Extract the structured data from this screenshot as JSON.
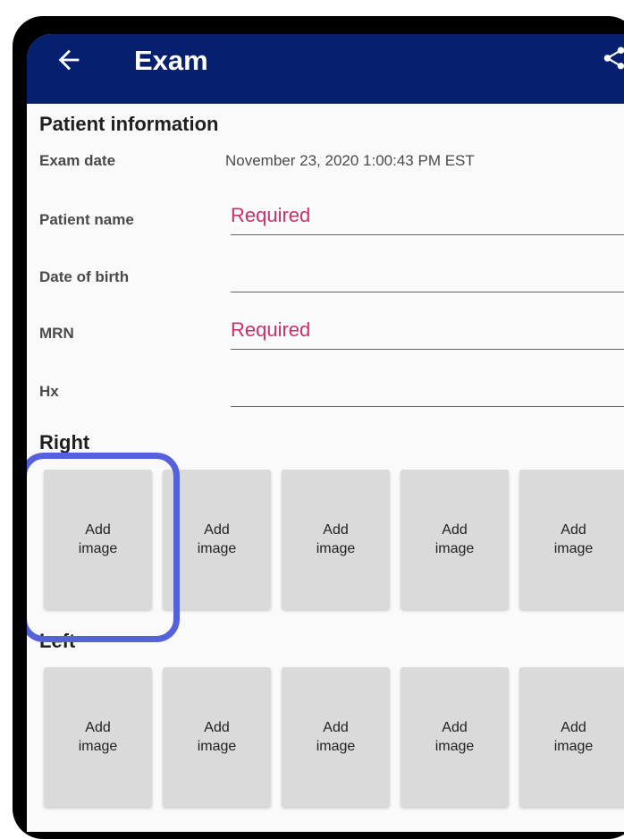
{
  "appbar": {
    "title": "Exam",
    "back_icon": "arrow-left-icon",
    "share_icon": "share-icon"
  },
  "patient_info": {
    "heading": "Patient information",
    "exam_date_label": "Exam date",
    "exam_date_value": "November 23, 2020 1:00:43 PM EST",
    "patient_name_label": "Patient name",
    "patient_name_placeholder": "Required",
    "dob_label": "Date of birth",
    "dob_placeholder": "",
    "mrn_label": "MRN",
    "mrn_placeholder": "Required",
    "hx_label": "Hx",
    "hx_placeholder": ""
  },
  "right": {
    "heading": "Right",
    "tiles": [
      "Add image",
      "Add image",
      "Add image",
      "Add image",
      "Add image"
    ]
  },
  "left": {
    "heading": "Left",
    "tiles": [
      "Add image",
      "Add image",
      "Add image",
      "Add image",
      "Add image"
    ]
  },
  "colors": {
    "appbar": "#061f6e",
    "required_text": "#c8316b",
    "focus_ring": "#5561d9",
    "tile": "#dadada"
  }
}
